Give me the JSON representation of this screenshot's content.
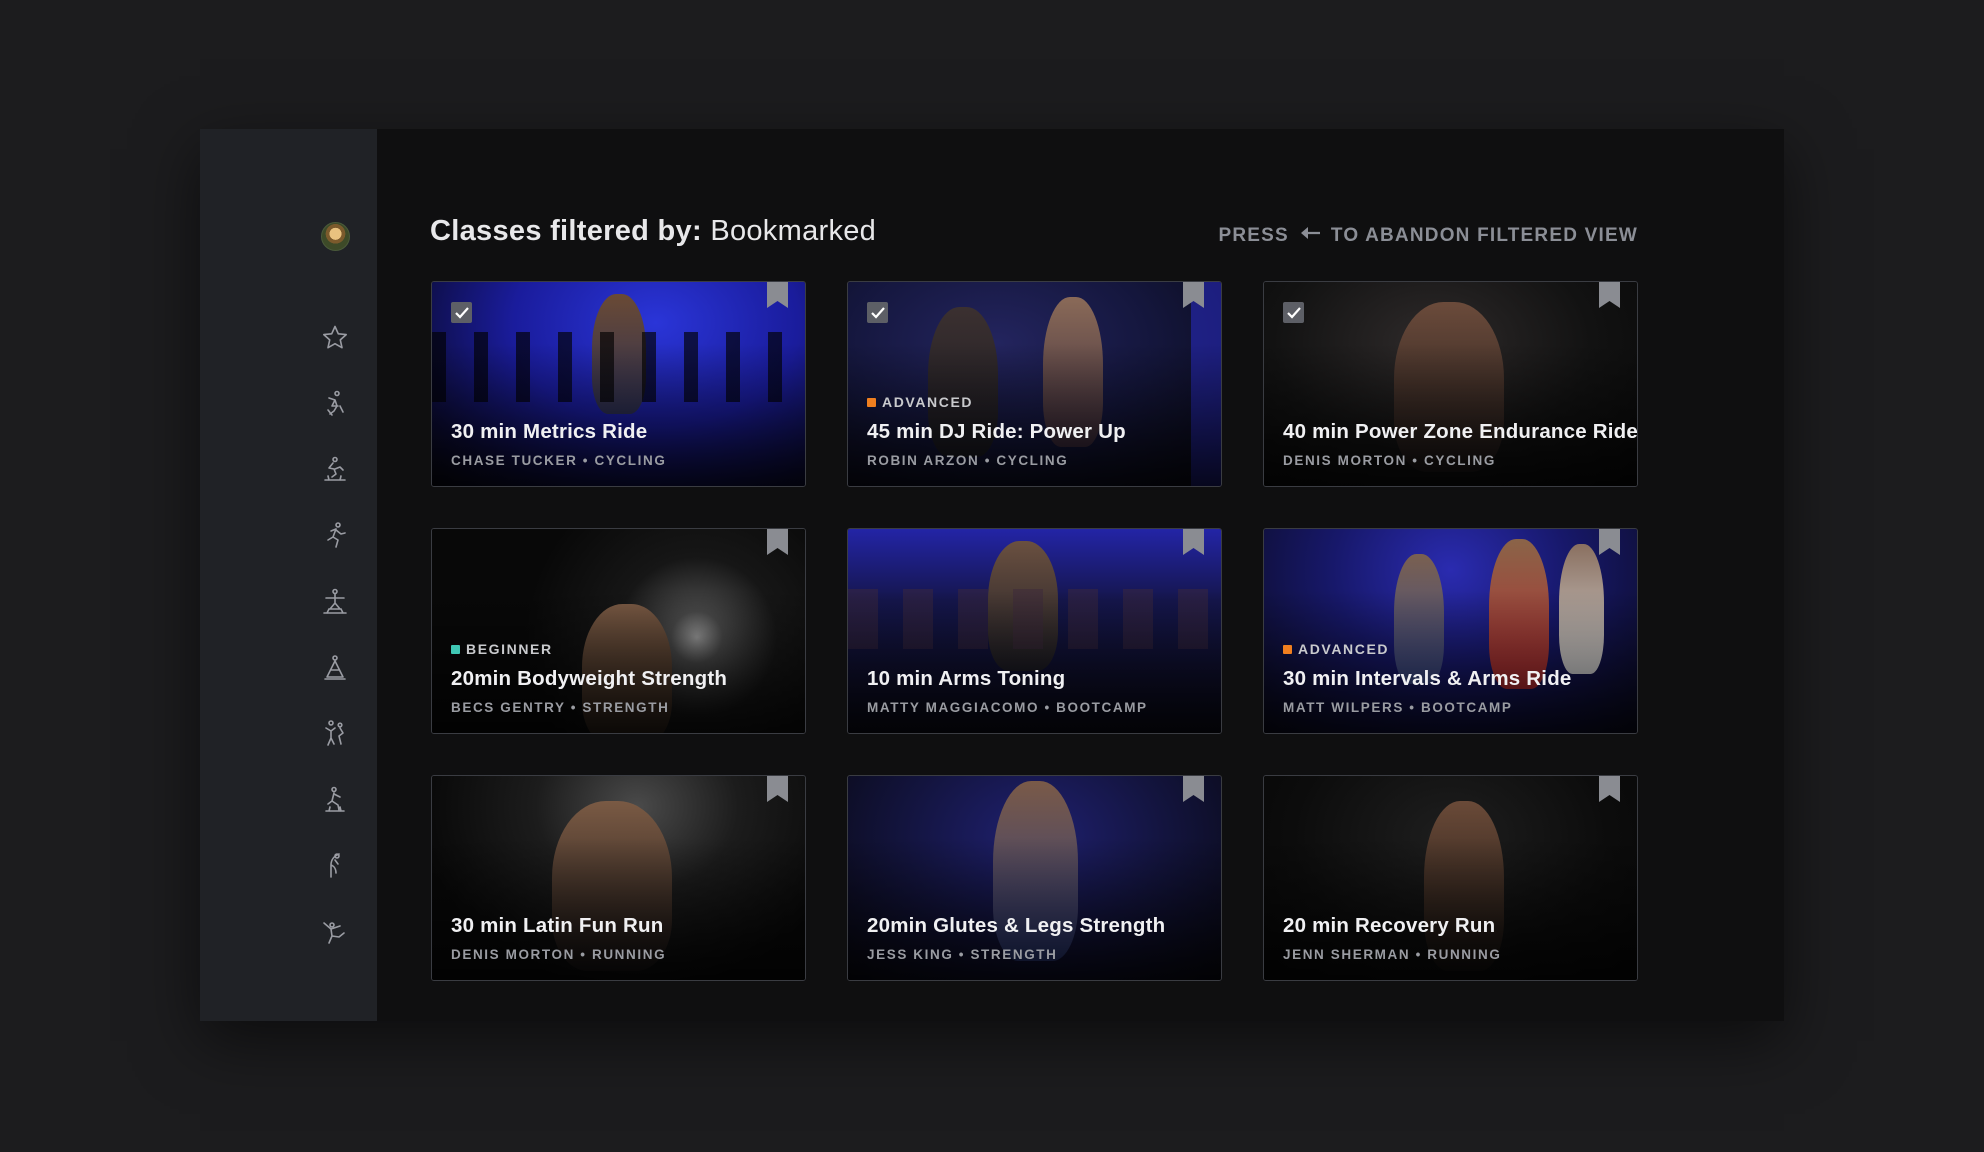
{
  "header": {
    "title_prefix": "Classes filtered by:",
    "title_filter": "Bookmarked",
    "hint_press": "PRESS",
    "hint_suffix": "TO ABANDON FILTERED VIEW"
  },
  "sidebar": {
    "items": [
      {
        "icon": "star-icon"
      },
      {
        "icon": "cycling-icon"
      },
      {
        "icon": "treadmill-icon"
      },
      {
        "icon": "running-icon"
      },
      {
        "icon": "strength-icon"
      },
      {
        "icon": "yoga-icon"
      },
      {
        "icon": "bootcamp-icon"
      },
      {
        "icon": "rowing-icon"
      },
      {
        "icon": "stretching-icon"
      },
      {
        "icon": "cardio-icon"
      }
    ]
  },
  "colors": {
    "advanced": "#f07f1f",
    "beginner": "#3fc7b4"
  },
  "cards": [
    {
      "title": "30 min Metrics Ride",
      "meta": "CHASE TUCKER • CYCLING",
      "level": "",
      "checked": true
    },
    {
      "title": "45 min DJ Ride: Power Up",
      "meta": "ROBIN ARZON • CYCLING",
      "level": "ADVANCED",
      "checked": true
    },
    {
      "title": "40 min Power Zone Endurance Ride",
      "meta": "DENIS MORTON • CYCLING",
      "level": "",
      "checked": true
    },
    {
      "title": "20min Bodyweight Strength",
      "meta": "BECS GENTRY • STRENGTH",
      "level": "BEGINNER",
      "checked": false
    },
    {
      "title": "10 min Arms Toning",
      "meta": "MATTY MAGGIACOMO • BOOTCAMP",
      "level": "",
      "checked": false
    },
    {
      "title": "30 min Intervals & Arms Ride",
      "meta": "MATT WILPERS • BOOTCAMP",
      "level": "ADVANCED",
      "checked": false
    },
    {
      "title": "30 min Latin Fun Run",
      "meta": "DENIS MORTON • RUNNING",
      "level": "",
      "checked": false
    },
    {
      "title": "20min Glutes & Legs Strength",
      "meta": "JESS KING • STRENGTH",
      "level": "",
      "checked": false
    },
    {
      "title": "20 min Recovery Run",
      "meta": "JENN SHERMAN • RUNNING",
      "level": "",
      "checked": false
    }
  ]
}
